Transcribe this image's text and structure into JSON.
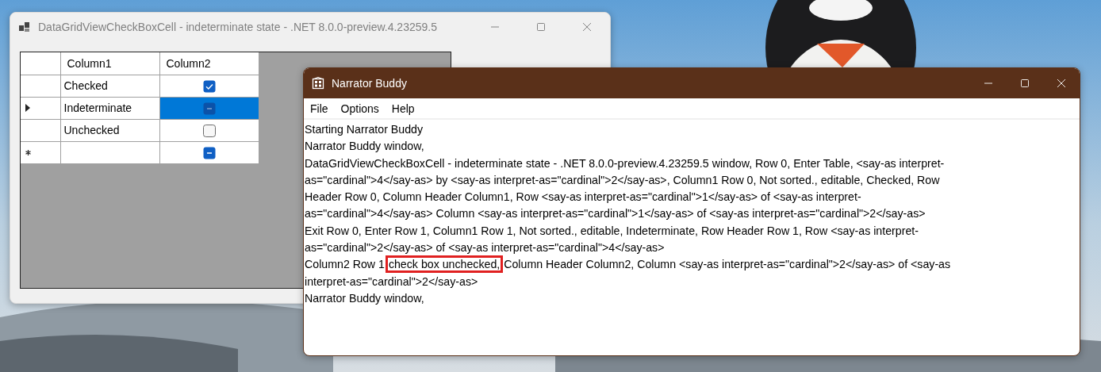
{
  "grid_window": {
    "title": "DataGridViewCheckBoxCell - indeterminate state - .NET 8.0.0-preview.4.23259.5",
    "columns": [
      "Column1",
      "Column2"
    ],
    "rows": [
      {
        "current_row": false,
        "new_row": false,
        "label": "Checked",
        "checked": true,
        "indeterminate": false,
        "selected": false
      },
      {
        "current_row": true,
        "new_row": false,
        "label": "Indeterminate",
        "checked": false,
        "indeterminate": true,
        "selected": true
      },
      {
        "current_row": false,
        "new_row": false,
        "label": "Unchecked",
        "checked": false,
        "indeterminate": false,
        "selected": false
      },
      {
        "current_row": false,
        "new_row": true,
        "label": "",
        "checked": false,
        "indeterminate": true,
        "selected": false
      }
    ]
  },
  "narrator_window": {
    "title": "Narrator Buddy",
    "menu": [
      "File",
      "Options",
      "Help"
    ],
    "log_lines": [
      {
        "text": "Starting Narrator Buddy"
      },
      {
        "text": "Narrator Buddy window,"
      },
      {
        "text": "DataGridViewCheckBoxCell - indeterminate state - .NET 8.0.0-preview.4.23259.5 window, Row 0, Enter Table, <say-as interpret-"
      },
      {
        "text": "as=\"cardinal\">4</say-as> by <say-as interpret-as=\"cardinal\">2</say-as>, Column1 Row 0, Not sorted., editable, Checked, Row"
      },
      {
        "text": "Header Row 0, Column Header Column1, Row <say-as interpret-as=\"cardinal\">1</say-as> of <say-as interpret-"
      },
      {
        "text": "as=\"cardinal\">4</say-as> Column <say-as interpret-as=\"cardinal\">1</say-as> of <say-as interpret-as=\"cardinal\">2</say-as>"
      },
      {
        "text": "Exit Row 0, Enter Row 1, Column1 Row 1, Not sorted., editable, Indeterminate, Row Header Row 1, Row <say-as interpret-"
      },
      {
        "text": "as=\"cardinal\">2</say-as> of <say-as interpret-as=\"cardinal\">4</say-as>"
      },
      {
        "before": "Column2 Row 1 ",
        "highlight": "check box unchecked,",
        "after": " Column Header Column2, Column <say-as interpret-as=\"cardinal\">2</say-as> of <say-as"
      },
      {
        "text": "interpret-as=\"cardinal\">2</say-as>"
      },
      {
        "text": "Narrator Buddy window,"
      }
    ]
  }
}
